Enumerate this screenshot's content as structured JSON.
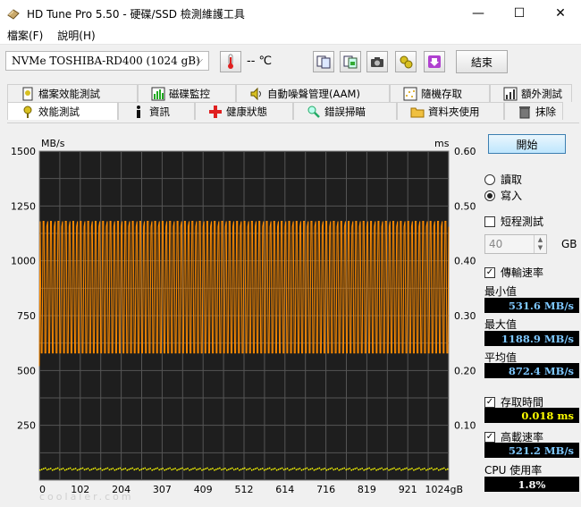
{
  "window": {
    "title": "HD Tune Pro 5.50 - 硬碟/SSD 檢測維護工具",
    "minimize": "—",
    "maximize": "☐",
    "close": "✕"
  },
  "menu": {
    "items": [
      "檔案(F)",
      "說明(H)"
    ]
  },
  "toolbar": {
    "drive": "NVMe    TOSHIBA-RD400 (1024 gB)",
    "temperature": "-- ℃",
    "exit_label": "結束"
  },
  "tabs": {
    "row1": [
      {
        "label": "檔案效能測試",
        "icon": "file-benchmark-icon"
      },
      {
        "label": "磁碟監控",
        "icon": "disk-monitor-icon"
      },
      {
        "label": "自動噪聲管理(AAM)",
        "icon": "speaker-icon"
      },
      {
        "label": "隨機存取",
        "icon": "random-access-icon"
      },
      {
        "label": "額外測試",
        "icon": "extra-tests-icon"
      }
    ],
    "row2": [
      {
        "label": "效能測試",
        "icon": "benchmark-icon"
      },
      {
        "label": "資訊",
        "icon": "info-icon"
      },
      {
        "label": "健康狀態",
        "icon": "health-icon"
      },
      {
        "label": "錯誤掃瞄",
        "icon": "error-scan-icon"
      },
      {
        "label": "資料夾使用",
        "icon": "folder-usage-icon"
      },
      {
        "label": "抹除",
        "icon": "erase-icon"
      }
    ]
  },
  "controls": {
    "start_label": "開始",
    "read_label": "讀取",
    "write_label": "寫入",
    "mode_selected": "write",
    "short_test_label": "短程測試",
    "short_test_checked": false,
    "short_test_value": "40",
    "short_test_unit": "GB",
    "transfer_rate_label": "傳輸速率",
    "transfer_rate_checked": true,
    "access_time_label": "存取時間",
    "access_time_checked": true,
    "burst_rate_label": "高載速率",
    "burst_rate_checked": true
  },
  "stats": {
    "min_label": "最小值",
    "min_value": "531.6 MB/s",
    "max_label": "最大值",
    "max_value": "1188.9 MB/s",
    "avg_label": "平均值",
    "avg_value": "872.4 MB/s",
    "access_time_value": "0.018 ms",
    "burst_rate_value": "521.2 MB/s",
    "cpu_label": "CPU 使用率",
    "cpu_value": "1.8%"
  },
  "watermark": "coolaler.com",
  "chart_data": {
    "type": "line",
    "y_left_label": "MB/s",
    "y_right_label": "ms",
    "y_left_ticks": [
      1500,
      1250,
      1000,
      750,
      500,
      250
    ],
    "y_right_ticks": [
      "0.60",
      "0.50",
      "0.40",
      "0.30",
      "0.20",
      "0.10"
    ],
    "x_ticks": [
      "0",
      "102",
      "204",
      "307",
      "409",
      "512",
      "614",
      "716",
      "819",
      "921",
      "1024gB"
    ],
    "ylim_left": [
      0,
      1500
    ],
    "ylim_right": [
      0,
      0.6
    ],
    "xlim": [
      0,
      1024
    ],
    "series": [
      {
        "kind": "transfer_rate",
        "color": "#ff8c00",
        "min": 580,
        "max": 1180
      },
      {
        "kind": "access_time",
        "color": "#ffff00",
        "value_ms": 0.018
      }
    ],
    "colors": {
      "background": "#1e1e1e",
      "grid": "#555555"
    }
  }
}
